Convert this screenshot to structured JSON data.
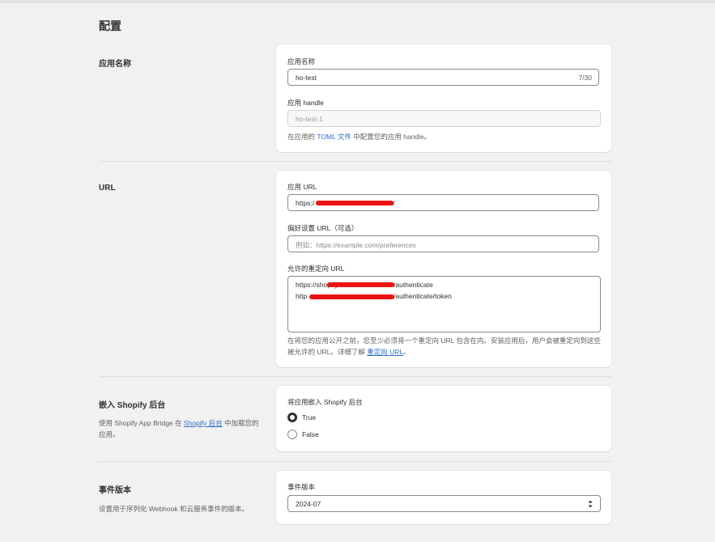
{
  "page": {
    "title": "配置"
  },
  "sections": {
    "app_name": {
      "title": "应用名称",
      "name_field": {
        "label": "应用名称",
        "value": "ho-test",
        "counter": "7/30"
      },
      "handle_field": {
        "label": "应用 handle",
        "value": "ho-test-1"
      },
      "help": {
        "before": "在应用的 ",
        "link": "TOML 文件",
        "after": " 中配置您的应用 handle。"
      }
    },
    "url": {
      "title": "URL",
      "app_url": {
        "label": "应用 URL",
        "value_start": "https:/",
        "value_end": "/"
      },
      "preferences_url": {
        "label": "偏好设置 URL（可选）",
        "placeholder": "例如：https://example.com/preferences"
      },
      "redirect_urls": {
        "label": "允许的重定向 URL",
        "lines": [
          {
            "start": "https://shopify.",
            "end": "/authenticate"
          },
          {
            "start": "http",
            "end": "/authenticate/token"
          }
        ]
      },
      "help": {
        "text": "在将您的应用公开之前，您至少必须将一个重定向 URL 包含在内。安装应用后，用户会被重定向到这些被允许的 URL。详细了解 ",
        "link": "重定向 URL",
        "after": "。"
      }
    },
    "embed": {
      "title": "嵌入 Shopify 后台",
      "desc_before": "使用 Shopify App Bridge 在 ",
      "desc_link": "Shopify 后台",
      "desc_after": " 中加载您的应用。",
      "field_label": "将应用嵌入 Shopify 后台",
      "options": [
        {
          "label": "True",
          "checked": true
        },
        {
          "label": "False",
          "checked": false
        }
      ]
    },
    "events": {
      "title": "事件版本",
      "desc": "设置用于序列化 Webhook 和云服务事件的版本。",
      "field_label": "事件版本",
      "selected": "2024-07"
    }
  },
  "colors": {
    "link": "#2c6ecb",
    "redaction": "#ee1212",
    "background": "#f1f1f1"
  }
}
